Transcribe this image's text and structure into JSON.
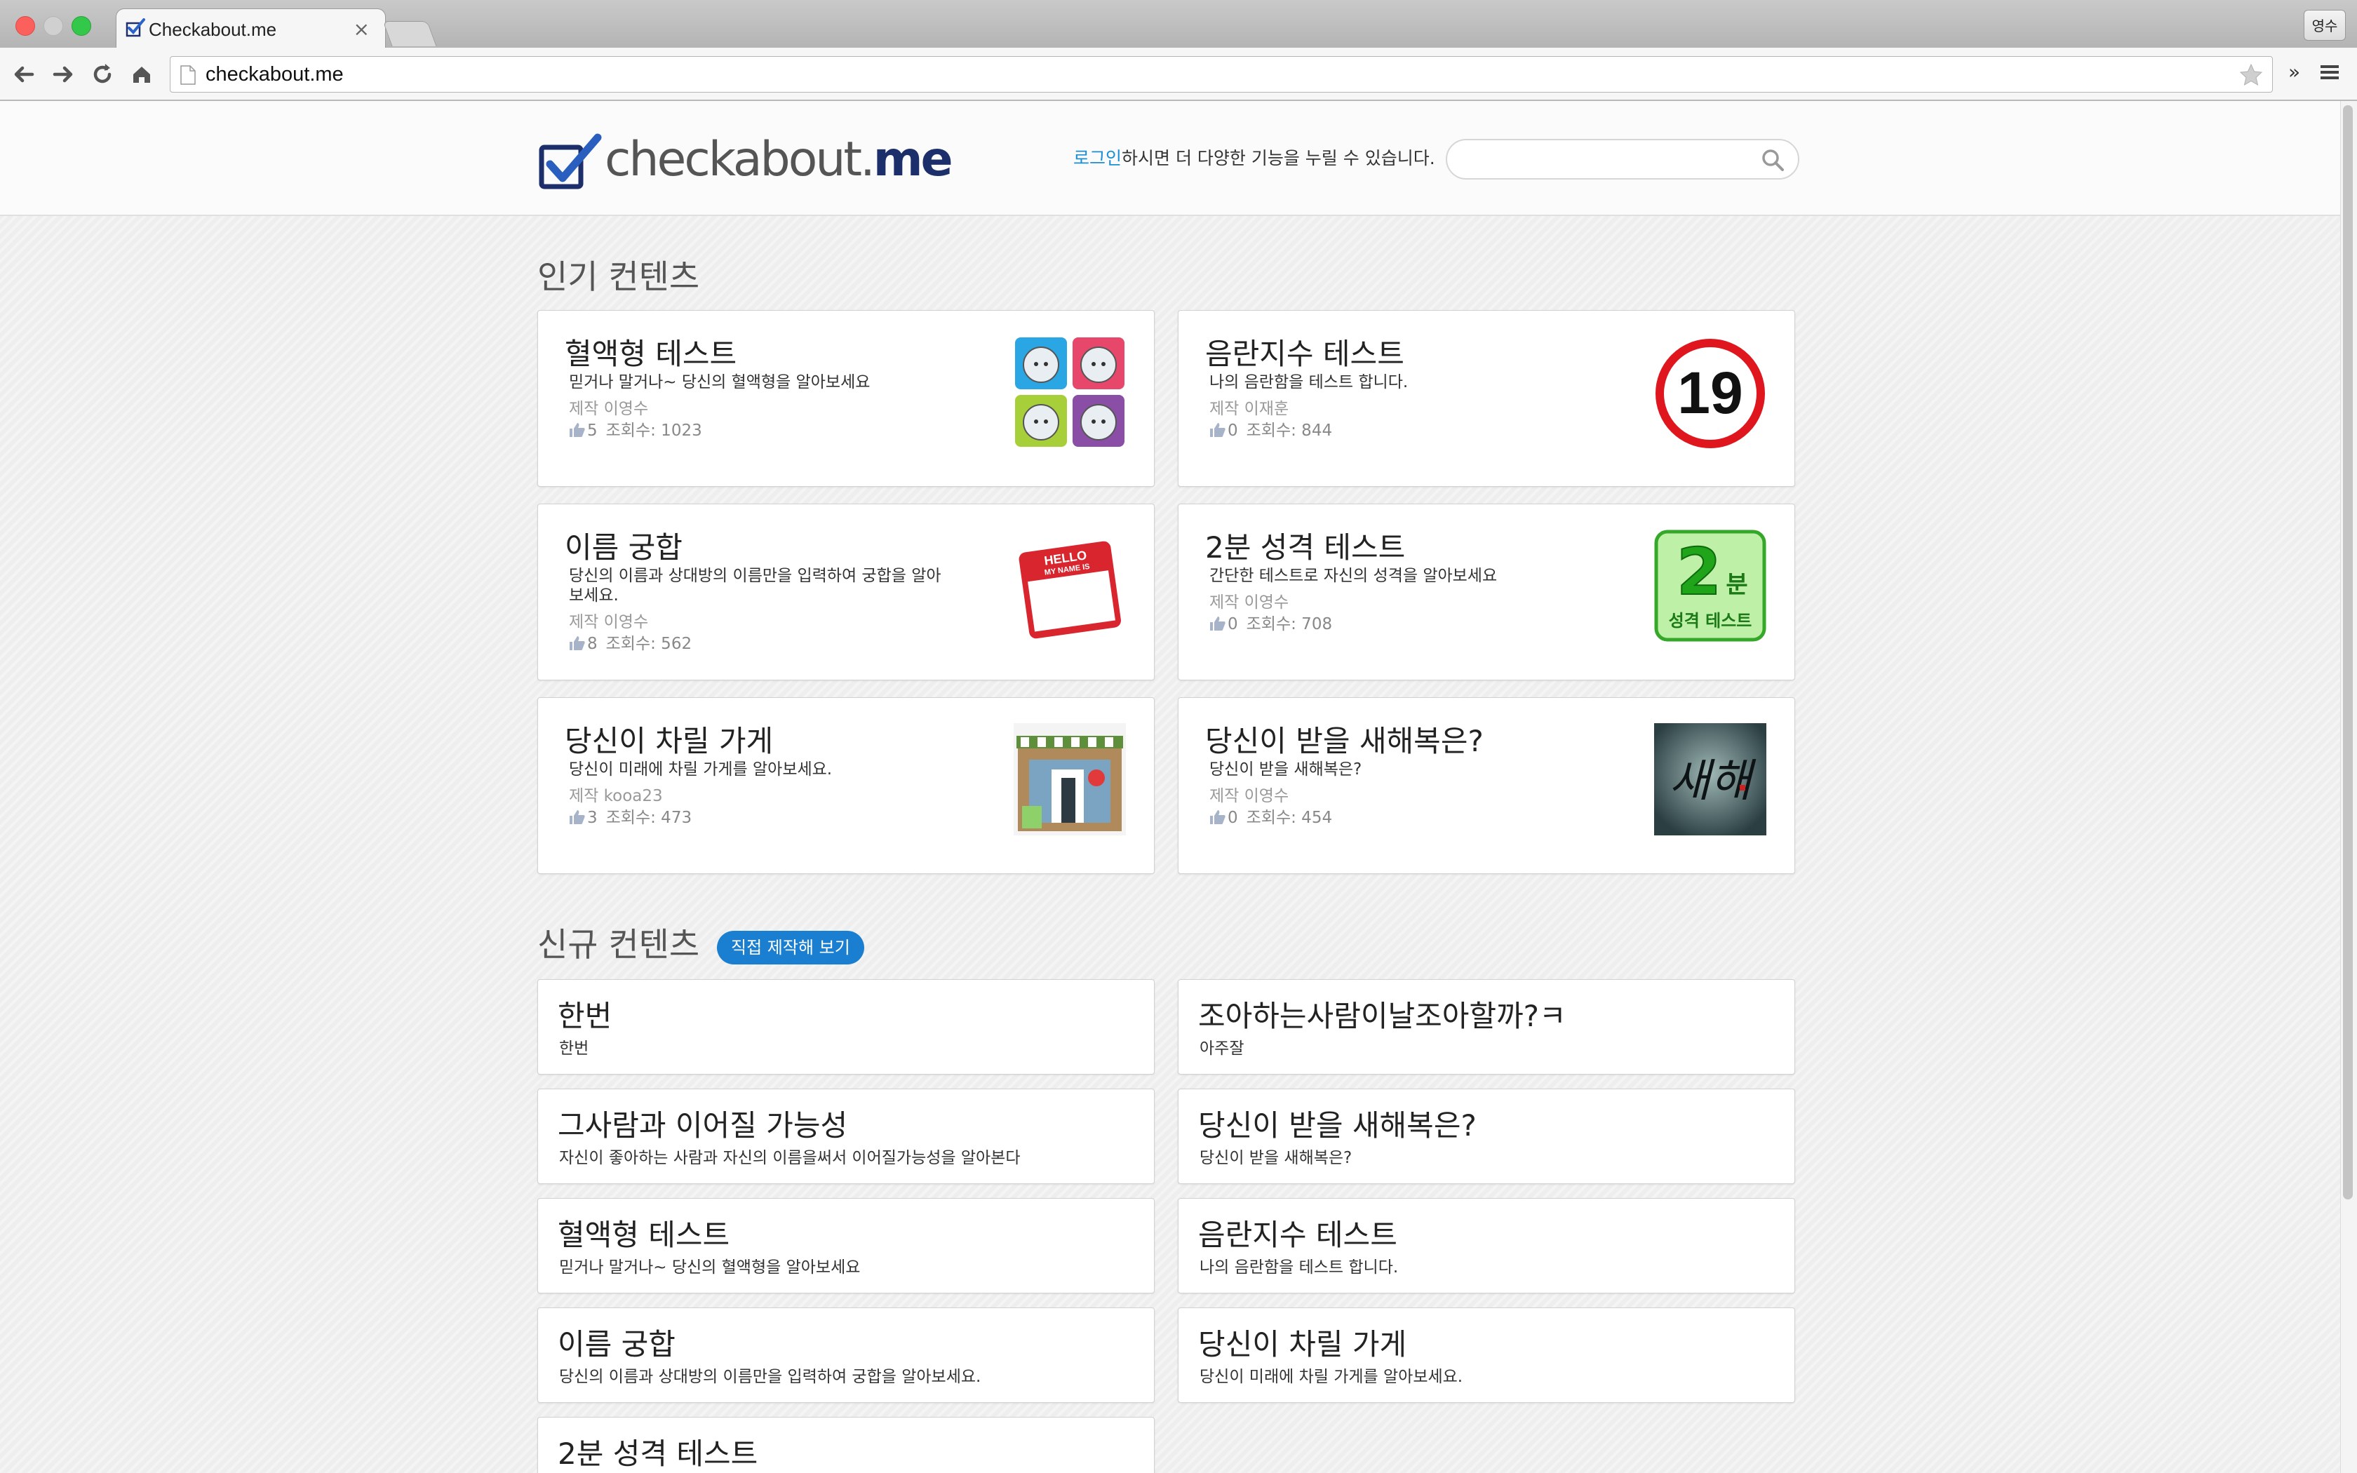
{
  "browser": {
    "tab_title": "Checkabout.me",
    "tab_close": "×",
    "url": "checkabout.me",
    "profile_label": "영수",
    "extend_label": "»"
  },
  "header": {
    "logo_main": "checkabout.",
    "logo_accent": "me",
    "login_link": "로그인",
    "login_message": "하시면 더 다양한 기능을 누릴 수 있습니다.",
    "search_placeholder": ""
  },
  "popular": {
    "section_title": "인기 컨텐츠",
    "items": [
      {
        "title": "혈액형 테스트",
        "description": "믿거나 말거나~ 당신의 혈액형을 알아보세요",
        "author": "제작 이영수",
        "likes": "5",
        "views": "조회수: 1023",
        "thumbnail": "blood-type-faces"
      },
      {
        "title": "음란지수 테스트",
        "description": "나의 음란함을 테스트 합니다.",
        "author": "제작 이재훈",
        "likes": "0",
        "views": "조회수: 844",
        "thumbnail": "age-19-sign",
        "thumb_text": "19"
      },
      {
        "title": "이름 궁합",
        "description": "당신의 이름과 상대방의 이름만을 입력하여 궁합을 알아보세요.",
        "author": "제작 이영수",
        "likes": "8",
        "views": "조회수: 562",
        "thumbnail": "hello-name-tag",
        "thumb_text": "HELLO",
        "thumb_sub": "MY NAME IS"
      },
      {
        "title": "2분 성격 테스트",
        "description": "간단한 테스트로 자신의 성격을 알아보세요",
        "author": "제작 이영수",
        "likes": "0",
        "views": "조회수: 708",
        "thumbnail": "two-minute-badge",
        "thumb_text": "2",
        "thumb_unit": "분",
        "thumb_sub": "성격 테스트"
      },
      {
        "title": "당신이 차릴 가게",
        "description": "당신이 미래에 차릴 가게를 알아보세요.",
        "author": "제작 kooa23",
        "likes": "3",
        "views": "조회수: 473",
        "thumbnail": "shop-front"
      },
      {
        "title": "당신이 받을 새해복은?",
        "description": "당신이 받을 새해복은?",
        "author": "제작 이영수",
        "likes": "0",
        "views": "조회수: 454",
        "thumbnail": "calligraphy-new-year",
        "thumb_text": "새해"
      }
    ]
  },
  "new_contents": {
    "section_title": "신규 컨텐츠",
    "make_button": "직접 제작해 보기",
    "items": [
      {
        "title": "한번",
        "description": "한번"
      },
      {
        "title": "조아하는사람이날조아할까?ㅋ",
        "description": "아주잘"
      },
      {
        "title": "그사람과 이어질 가능성",
        "description": "자신이 좋아하는 사람과 자신의 이름을써서 이어질가능성을 알아본다"
      },
      {
        "title": "당신이 받을 새해복은?",
        "description": "당신이 받을 새해복은?"
      },
      {
        "title": "혈액형 테스트",
        "description": "믿거나 말거나~ 당신의 혈액형을 알아보세요"
      },
      {
        "title": "음란지수 테스트",
        "description": "나의 음란함을 테스트 합니다."
      },
      {
        "title": "이름 궁합",
        "description": "당신의 이름과 상대방의 이름만을 입력하여 궁합을 알아보세요."
      },
      {
        "title": "당신이 차릴 가게",
        "description": "당신이 미래에 차릴 가게를 알아보세요."
      },
      {
        "title": "2분 성격 테스트",
        "description": ""
      }
    ]
  },
  "colors": {
    "accent": "#1a7fd0",
    "logo_dark": "#1d2f6b",
    "link": "#1a8fd6",
    "page_bg": "#eeeeee"
  }
}
